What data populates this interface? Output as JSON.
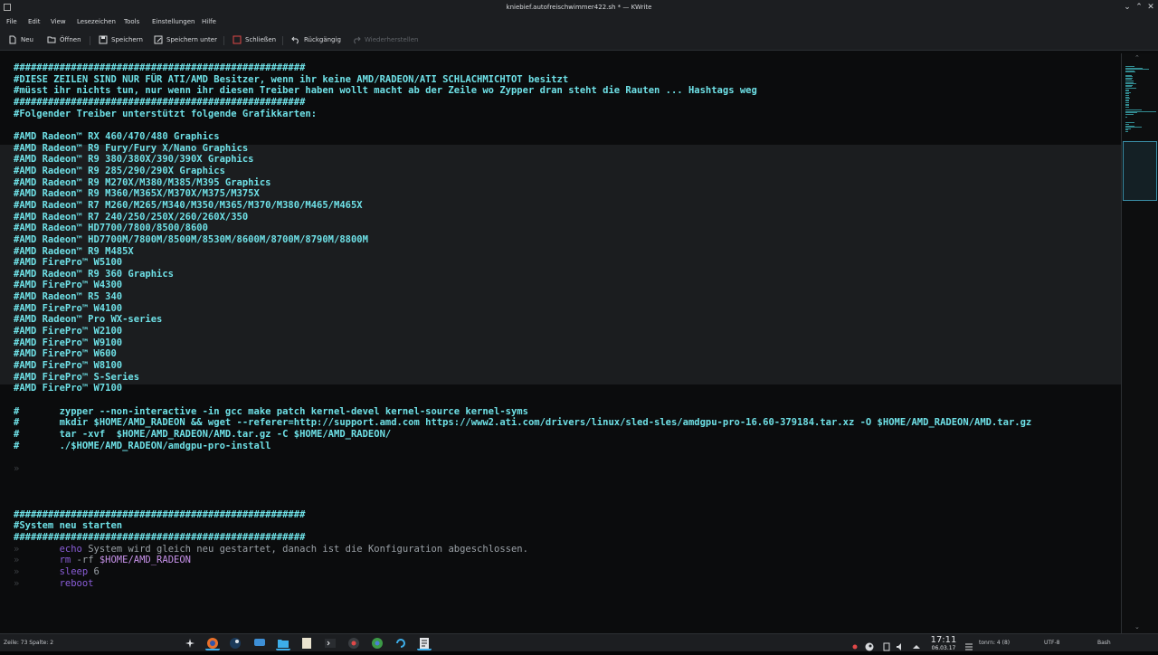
{
  "window": {
    "title": "kniebief.autofreischwimmer422.sh * — KWrite"
  },
  "menu": [
    "File",
    "Edit",
    "View",
    "Lesezeichen",
    "Tools",
    "Einstellungen",
    "Hilfe"
  ],
  "toolbar": {
    "new_label": "Neu",
    "open_label": "Öffnen",
    "save_label": "Speichern",
    "save_as_label": "Speichern unter",
    "close_label": "Schließen",
    "undo_label": "Rückgängig",
    "redo_label": "Wiederherstellen"
  },
  "editor": {
    "lines": [
      {
        "cls": "c-com",
        "text": "###################################################"
      },
      {
        "cls": "c-com",
        "text": "#DIESE ZEILEN SIND NUR FÜR ATI/AMD Besitzer, wenn ihr keine AMD/RADEON/ATI SCHLACHMICHTOT besitzt"
      },
      {
        "cls": "c-com",
        "text": "#müsst ihr nichts tun, nur wenn ihr diesen Treiber haben wollt macht ab der Zeile wo Zypper dran steht die Rauten ... Hashtags weg"
      },
      {
        "cls": "c-com",
        "text": "###################################################"
      },
      {
        "cls": "c-com",
        "text": "#Folgender Treiber unterstützt folgende Grafikkarten:"
      },
      {
        "cls": "c-com",
        "text": ""
      },
      {
        "cls": "c-com",
        "text": "#AMD Radeon™ RX 460/470/480 Graphics"
      },
      {
        "cls": "c-com",
        "text": "#AMD Radeon™ R9 Fury/Fury X/Nano Graphics"
      },
      {
        "cls": "c-com",
        "text": "#AMD Radeon™ R9 380/380X/390/390X Graphics"
      },
      {
        "cls": "c-com",
        "text": "#AMD Radeon™ R9 285/290/290X Graphics"
      },
      {
        "cls": "c-com",
        "text": "#AMD Radeon™ R9 M270X/M380/M385/M395 Graphics"
      },
      {
        "cls": "c-com",
        "text": "#AMD Radeon™ R9 M360/M365X/M370X/M375/M375X"
      },
      {
        "cls": "c-com",
        "text": "#AMD Radeon™ R7 M260/M265/M340/M350/M365/M370/M380/M465/M465X"
      },
      {
        "cls": "c-com",
        "text": "#AMD Radeon™ R7 240/250/250X/260/260X/350"
      },
      {
        "cls": "c-com",
        "text": "#AMD Radeon™ HD7700/7800/8500/8600"
      },
      {
        "cls": "c-com",
        "text": "#AMD Radeon™ HD7700M/7800M/8500M/8530M/8600M/8700M/8790M/8800M"
      },
      {
        "cls": "c-com",
        "text": "#AMD Radeon™ R9 M485X"
      },
      {
        "cls": "c-com",
        "text": "#AMD FirePro™ W5100"
      },
      {
        "cls": "c-com",
        "text": "#AMD Radeon™ R9 360 Graphics"
      },
      {
        "cls": "c-com",
        "text": "#AMD FirePro™ W4300"
      },
      {
        "cls": "c-com",
        "text": "#AMD Radeon™ R5 340"
      },
      {
        "cls": "c-com",
        "text": "#AMD FirePro™ W4100"
      },
      {
        "cls": "c-com",
        "text": "#AMD Radeon™ Pro WX-series"
      },
      {
        "cls": "c-com",
        "text": "#AMD FirePro™ W2100"
      },
      {
        "cls": "c-com",
        "text": "#AMD FirePro™ W9100"
      },
      {
        "cls": "c-com",
        "text": "#AMD FirePro™ W600"
      },
      {
        "cls": "c-com",
        "text": "#AMD FirePro™ W8100"
      },
      {
        "cls": "c-com",
        "text": "#AMD FirePro™ S-Series"
      },
      {
        "cls": "c-com",
        "text": "#AMD FirePro™ W7100"
      },
      {
        "cls": "c-com",
        "text": ""
      },
      {
        "cls": "c-com",
        "text": "#       zypper --non-interactive -in gcc make patch kernel-devel kernel-source kernel-syms"
      },
      {
        "cls": "c-com",
        "text": "#       mkdir $HOME/AMD_RADEON && wget --referer=http://support.amd.com https://www2.ati.com/drivers/linux/sled-sles/amdgpu-pro-16.60-379184.tar.xz -O $HOME/AMD_RADEON/AMD.tar.gz"
      },
      {
        "cls": "c-com",
        "text": "#       tar -xvf  $HOME/AMD_RADEON/AMD.tar.gz -C $HOME/AMD_RADEON/"
      },
      {
        "cls": "c-com",
        "text": "#       ./$HOME/AMD_RADEON/amdgpu-pro-install"
      },
      {
        "cls": "c-com",
        "text": ""
      },
      {
        "cls": "c-dim",
        "text": "»"
      },
      {
        "cls": "c-com",
        "text": ""
      },
      {
        "cls": "c-com",
        "text": ""
      },
      {
        "cls": "c-com",
        "text": ""
      },
      {
        "cls": "c-com",
        "text": "###################################################"
      },
      {
        "cls": "c-com",
        "text": "#System neu starten"
      },
      {
        "cls": "c-com",
        "text": "###################################################"
      }
    ],
    "code_tail": [
      {
        "kw": "echo",
        "rest": " System wird gleich neu gestartet, danach ist die Konfiguration abgeschlossen."
      },
      {
        "kw": "rm",
        "rest": " -rf ",
        "var": "$HOME/AMD_RADEON"
      },
      {
        "kw": "sleep",
        "rest": " 6"
      },
      {
        "kw": "reboot",
        "rest": ""
      }
    ],
    "indent_marker": "»"
  },
  "statusbar": {
    "position": "Zeile: 73 Spalte: 2",
    "mode": "tonrn: 4 (8)",
    "encoding": "UTF-8",
    "syntax": "Bash"
  },
  "clock": {
    "time": "17:11",
    "date": "06.03.17"
  },
  "colors": {
    "comment": "#6ee0e6",
    "keyword": "#8a5dd8",
    "accent": "#3daee9"
  }
}
